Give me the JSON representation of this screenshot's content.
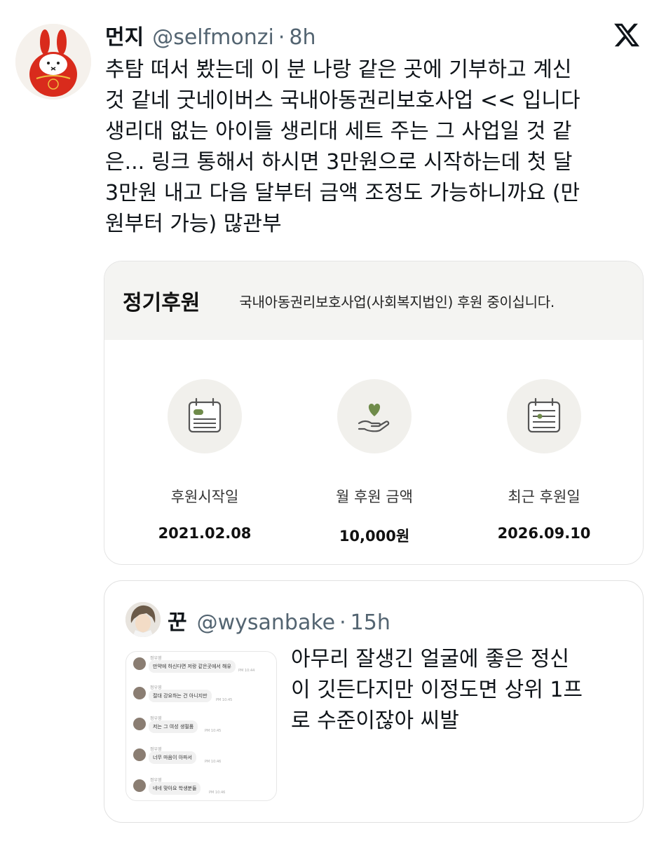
{
  "tweet": {
    "display_name": "먼지",
    "handle": "@selfmonzi",
    "separator": "·",
    "time": "8h",
    "text": "추탐 떠서 봤는데 이 분 나랑 같은 곳에 기부하고 계신\n것 같네 굿네이버스 국내아동권리보호사업 << 입니다\n생리대 없는 아이들 생리대 세트 주는 그 사업일 것 같\n은... 링크 통해서 하시면 3만원으로 시작하는데 첫 달\n3만원 내고 다음 달부터 금액 조정도 가능하니까요 (만\n원부터 가능) 많관부",
    "avatar_icon": "bunny-daruma-avatar",
    "logo_icon": "x-logo-icon"
  },
  "donation_card": {
    "title": "정기후원",
    "description": "국내아동권리보호사업(사회복지법인) 후원 중이십니다.",
    "stats": [
      {
        "icon": "calendar-icon",
        "label": "후원시작일",
        "value": "2021.02.08"
      },
      {
        "icon": "heart-hand-icon",
        "label": "월 후원 금액",
        "value": "10,000원"
      },
      {
        "icon": "calendar-slider-icon",
        "label": "최근 후원일",
        "value": "2026.09.10"
      }
    ]
  },
  "quoted_tweet": {
    "display_name": "꾼",
    "handle": "@wysanbake",
    "separator": "·",
    "time": "15h",
    "text": "아무리 잘생긴 얼굴에 좋은 정신\n이 깃든다지만 이정도면 상위 1프\n로 수준이잖아 씨발",
    "thumbnail_messages": [
      {
        "name": "정우영",
        "text": "만약에 하신다면 저랑 같은곳에서 해유",
        "time": "PM 10:44"
      },
      {
        "name": "정우영",
        "text": "절대 강요하는 건 아니지만",
        "time": "PM 10:45"
      },
      {
        "name": "정우영",
        "text": "저는 그 여성 생필품",
        "time": "PM 10:45"
      },
      {
        "name": "정우영",
        "text": "너무 마음이 아파서",
        "time": "PM 10:46"
      },
      {
        "name": "정우영",
        "text": "네네 맞아요 학생분들",
        "time": "PM 10:46"
      }
    ]
  },
  "colors": {
    "text": "#0f1419",
    "secondary": "#536471",
    "icon_green": "#6f8b4a",
    "card_header_bg": "#f4f4f2",
    "icon_circle_bg": "#f1f0ec"
  }
}
